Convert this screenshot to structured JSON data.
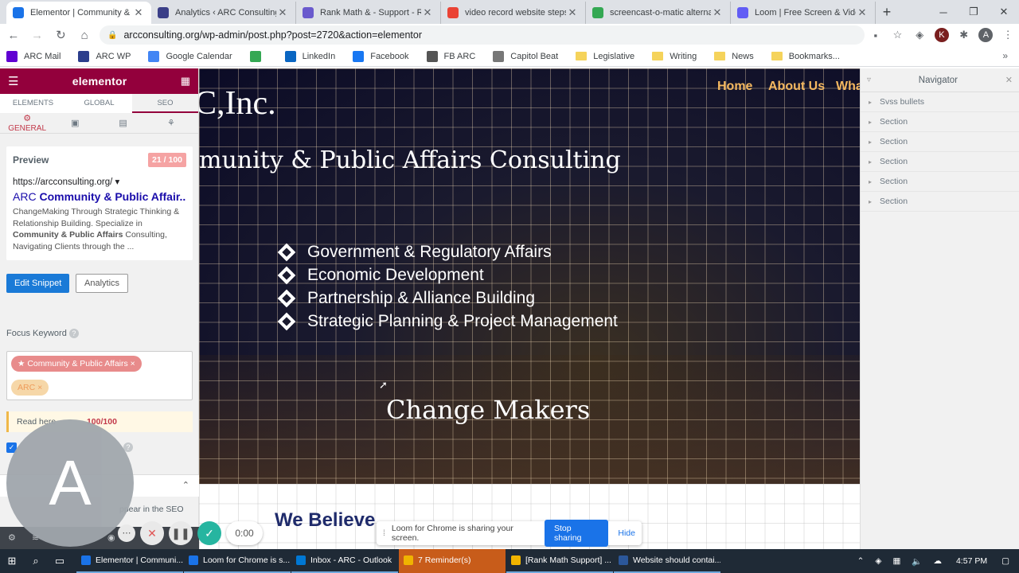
{
  "browser": {
    "tabs": [
      {
        "title": "Elementor | Community & Pu",
        "color": "#1a73e8",
        "active": true
      },
      {
        "title": "Analytics ‹ ARC Consulting —",
        "color": "#3b3f88"
      },
      {
        "title": "Rank Math & - Support - Ra",
        "color": "#6a5acd"
      },
      {
        "title": "video record website steps fo",
        "color": "#ea4335"
      },
      {
        "title": "screencast-o-matic alternativ",
        "color": "#34a853"
      },
      {
        "title": "Loom | Free Screen & Video",
        "color": "#625df5"
      }
    ],
    "url": "arcconsulting.org/wp-admin/post.php?post=2720&action=elementor",
    "profile_initial": "A",
    "profile_initial2": "K"
  },
  "bookmarks": [
    {
      "label": "ARC Mail",
      "color": "#6001d2",
      "folder": false
    },
    {
      "label": "ARC WP",
      "color": "#2c3e8c",
      "folder": false
    },
    {
      "label": "Google Calendar",
      "color": "#4285f4",
      "folder": false
    },
    {
      "label": "",
      "color": "#34a853",
      "folder": false
    },
    {
      "label": "LinkedIn",
      "color": "#0a66c2",
      "folder": false
    },
    {
      "label": "Facebook",
      "color": "#1877f2",
      "folder": false
    },
    {
      "label": "FB ARC",
      "color": "#555555",
      "folder": false
    },
    {
      "label": "Capitol Beat",
      "color": "#777777",
      "folder": false
    },
    {
      "label": "Legislative",
      "folder": true
    },
    {
      "label": "Writing",
      "folder": true
    },
    {
      "label": "News",
      "folder": true
    },
    {
      "label": "Bookmarks...",
      "folder": true
    }
  ],
  "panel": {
    "logo": "elementor",
    "tabs": [
      "ELEMENTS",
      "GLOBAL",
      "SEO"
    ],
    "subtab_general": "GENERAL",
    "preview_label": "Preview",
    "score": "21 / 100",
    "preview_url": "https://arcconsulting.org/ ▾",
    "preview_link_prefix": "ARC ",
    "preview_link_bold": "Community & Public Affair...",
    "preview_desc_1": "ChangeMaking Through Strategic Thinking & Relationship Building. Specialize in ",
    "preview_desc_bold": "Community & Public Affairs",
    "preview_desc_2": " Consulting, Navigating Clients through the ...",
    "edit_snippet": "Edit Snippet",
    "analytics": "Analytics",
    "focus_keyword": "Focus Keyword",
    "keywords": [
      "★ Community & Public Affairs  ×",
      "ARC  ×"
    ],
    "read_here": "Read here",
    "read_score": "100/100",
    "seo_appear": "ppear in the SEO",
    "avatar_letter": "A"
  },
  "canvas": {
    "brand": "C,Inc.",
    "tagline": "munity & Public Affairs Consulting",
    "nav": [
      "Home",
      "About Us",
      "Wha"
    ],
    "bullets": [
      "Government & Regulatory Affairs",
      "Economic Development",
      "Partnership & Alliance Building",
      "Strategic Planning & Project Management"
    ],
    "change_makers": "Change Makers",
    "we_believe": "We Believe"
  },
  "navigator": {
    "title": "Navigator",
    "items": [
      "Svss bullets",
      "Section",
      "Section",
      "Section",
      "Section",
      "Section"
    ]
  },
  "loom": {
    "sharing_text": "Loom for Chrome is sharing your screen.",
    "stop": "Stop sharing",
    "hide": "Hide",
    "time": "0:00"
  },
  "taskbar": {
    "tasks": [
      {
        "label": "Elementor | Communi...",
        "color": "#1a73e8"
      },
      {
        "label": "Loom for Chrome is s...",
        "color": "#1a73e8"
      },
      {
        "label": "Inbox - ARC - Outlook",
        "color": "#0078d4"
      },
      {
        "label": "7 Reminder(s)",
        "color": "#f0b400",
        "orange": true
      },
      {
        "label": "[Rank Math Support] ...",
        "color": "#f0b400"
      },
      {
        "label": "Website should contai...",
        "color": "#2b579a"
      }
    ],
    "time": "4:57 PM"
  }
}
